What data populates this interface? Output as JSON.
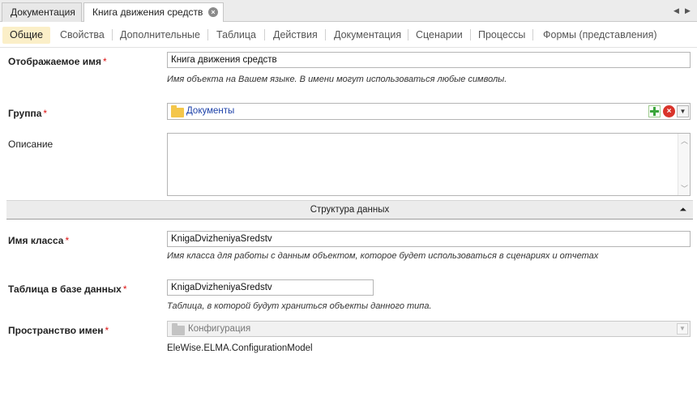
{
  "doc_tabs": [
    {
      "label": "Документация"
    },
    {
      "label": "Книга движения средств"
    }
  ],
  "section_tabs": [
    {
      "label": "Общие"
    },
    {
      "label": "Свойства"
    },
    {
      "label": "Дополнительные"
    },
    {
      "label": "Таблица"
    },
    {
      "label": "Действия"
    },
    {
      "label": "Документация"
    },
    {
      "label": "Сценарии"
    },
    {
      "label": "Процессы"
    },
    {
      "label": "Формы (представления)"
    }
  ],
  "form": {
    "required_mark": "*",
    "display_name": {
      "label": "Отображаемое имя",
      "value": "Книга движения средств",
      "hint": "Имя объекта на Вашем языке. В имени могут использоваться любые символы."
    },
    "group": {
      "label": "Группа",
      "value": "Документы"
    },
    "description": {
      "label": "Описание",
      "value": ""
    },
    "data_structure": {
      "title": "Структура данных"
    },
    "class_name": {
      "label": "Имя класса",
      "value": "KnigaDvizheniyaSredstv",
      "hint": "Имя класса для работы с данным объектом, которое будет использоваться в сценариях и отчетах"
    },
    "db_table": {
      "label": "Таблица в базе данных",
      "value": "KnigaDvizheniyaSredstv",
      "hint": "Таблица, в которой будут храниться объекты данного типа."
    },
    "namespace": {
      "label": "Пространство имен",
      "selected": "Конфигурация",
      "full_value": "EleWise.ELMA.ConfigurationModel"
    }
  },
  "icons": [
    "close-icon",
    "chevron-left-icon",
    "chevron-right-icon",
    "folder-icon",
    "add-icon",
    "remove-icon",
    "chevron-down-icon",
    "double-chevron-up-icon"
  ]
}
